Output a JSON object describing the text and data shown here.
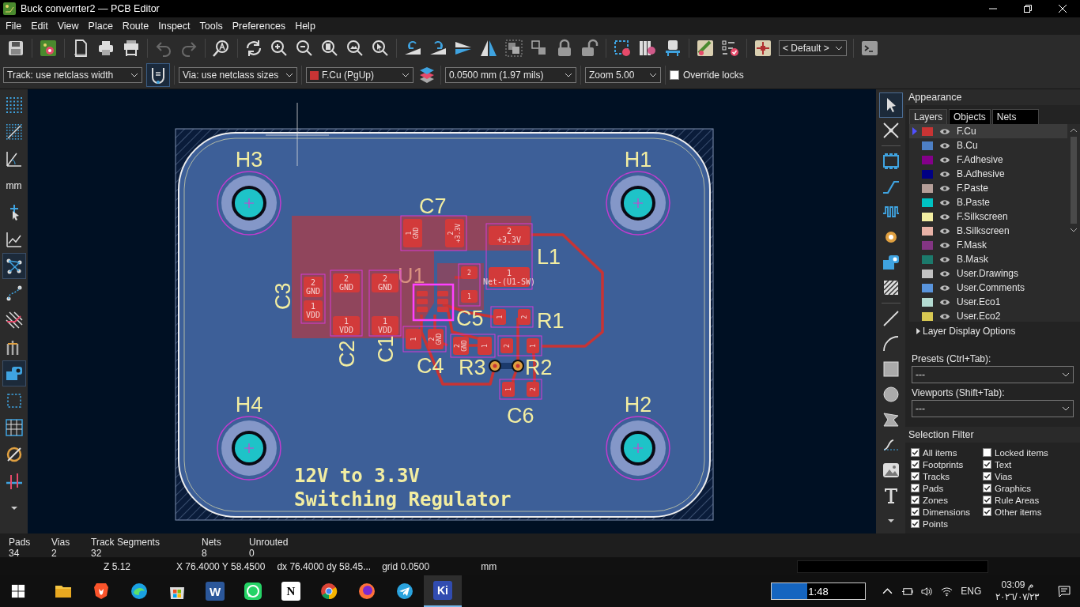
{
  "window": {
    "title": "Buck converrter2 — PCB Editor"
  },
  "menu": [
    "File",
    "Edit",
    "View",
    "Place",
    "Route",
    "Inspect",
    "Tools",
    "Preferences",
    "Help"
  ],
  "toolbar": [
    {
      "disabled": false
    },
    {
      "disabled": false
    },
    {
      "disabled": false
    },
    {
      "disabled": false
    },
    {
      "disabled": false
    },
    {
      "disabled": true
    },
    {
      "disabled": true
    },
    {
      "disabled": false
    },
    {
      "disabled": false
    },
    {
      "disabled": false
    },
    {
      "disabled": false
    },
    {
      "disabled": false
    },
    {
      "disabled": false
    },
    {
      "disabled": false
    },
    {
      "disabled": false
    },
    {
      "disabled": false
    },
    {
      "disabled": false
    },
    {
      "disabled": false
    },
    {
      "disabled": false
    },
    {
      "disabled": false
    },
    {
      "disabled": false
    },
    {
      "disabled": false
    },
    {
      "disabled": false
    },
    {
      "disabled": false
    },
    {
      "disabled": false
    },
    {
      "disabled": false
    },
    {
      "disabled": false
    },
    {
      "disabled": false
    },
    {
      "disabled": false
    }
  ],
  "viewport_dropdown": "< Default >",
  "options_bar": {
    "track": "Track: use netclass width",
    "via": "Via: use netclass sizes",
    "layer": {
      "label": "F.Cu (PgUp)",
      "color": "#c83434"
    },
    "grid": "0.0500 mm (1.97 mils)",
    "zoom": "Zoom 5.00",
    "override_locks": {
      "label": "Override locks",
      "checked": false
    }
  },
  "left_toolbar": [
    {
      "selected": false
    },
    {
      "selected": false
    },
    {
      "selected": false
    },
    {
      "selected": false,
      "label": "mm"
    },
    {
      "selected": false
    },
    {
      "selected": false
    },
    {
      "selected": true
    },
    {
      "selected": false
    },
    {
      "selected": false
    },
    {
      "selected": false
    },
    {
      "selected": true
    },
    {
      "selected": false
    },
    {
      "selected": false
    },
    {
      "selected": false
    },
    {
      "selected": false
    },
    {
      "selected": false
    }
  ],
  "right_toolbar": [
    {
      "selected": true
    },
    {
      "selected": false
    },
    {
      "selected": false
    },
    {
      "selected": false
    },
    {
      "selected": false
    },
    {
      "selected": false
    },
    {
      "selected": false
    },
    {
      "selected": false
    },
    {
      "selected": false
    },
    {
      "selected": false
    },
    {
      "selected": false
    },
    {
      "selected": false
    },
    {
      "selected": false
    },
    {
      "selected": false
    },
    {
      "selected": false
    },
    {
      "selected": false
    },
    {
      "selected": false
    }
  ],
  "board": {
    "holes": [
      {
        "ref": "H3"
      },
      {
        "ref": "H1"
      },
      {
        "ref": "H4"
      },
      {
        "ref": "H2"
      }
    ],
    "components": [
      {
        "ref": "C7",
        "color": "#f2eda1",
        "pads": [
          {
            "number": "1",
            "net": "GND"
          },
          {
            "number": "2",
            "net": "+3.3V"
          }
        ]
      },
      {
        "ref": "U1",
        "color": "#d9917f"
      },
      {
        "ref": "L1",
        "color": "#f2eda1",
        "pads": [
          {
            "number": "2",
            "net": "+3.3V"
          },
          {
            "number": "1",
            "net": "Net-(U1-SW)"
          }
        ]
      },
      {
        "ref": "C3",
        "color": "#f2eda1",
        "pads": [
          {
            "number": "2",
            "net": "GND"
          },
          {
            "number": "1",
            "net": "VDD"
          }
        ]
      },
      {
        "ref": "C2",
        "color": "#f2eda1",
        "pads": [
          {
            "number": "2",
            "net": "GND"
          },
          {
            "number": "1",
            "net": "VDD"
          }
        ]
      },
      {
        "ref": "C1",
        "color": "#f2eda1",
        "pads": [
          {
            "number": "2",
            "net": "GND"
          },
          {
            "number": "1",
            "net": "VDD"
          }
        ]
      },
      {
        "ref": "C5",
        "color": "#f2eda1",
        "pads": [
          {
            "number": "2"
          },
          {
            "number": "1"
          }
        ]
      },
      {
        "ref": "R1",
        "color": "#f2eda1",
        "pads": [
          {
            "number": "1"
          },
          {
            "number": "2"
          }
        ]
      },
      {
        "ref": "C4",
        "color": "#f2eda1",
        "pads": [
          {
            "number": "1"
          },
          {
            "number": "2",
            "net": "GND"
          }
        ]
      },
      {
        "ref": "R3",
        "color": "#f2eda1",
        "pads": [
          {
            "number": "2",
            "net": "GND"
          },
          {
            "number": "1"
          }
        ]
      },
      {
        "ref": "R2",
        "color": "#f2eda1",
        "pads": [
          {
            "number": "2"
          },
          {
            "number": "1"
          }
        ]
      },
      {
        "ref": "C6",
        "color": "#f2eda1",
        "pads": [
          {
            "number": "1"
          },
          {
            "number": "2"
          }
        ]
      }
    ],
    "title_lines": [
      "12V to 3.3V",
      "Switching Regulator"
    ]
  },
  "appearance": {
    "title": "Appearance",
    "tabs": [
      {
        "label": "Layers",
        "selected": true
      },
      {
        "label": "Objects",
        "selected": false
      },
      {
        "label": "Nets",
        "selected": false
      }
    ],
    "layers": [
      {
        "name": "F.Cu",
        "color": "#c83434",
        "selected": true
      },
      {
        "name": "B.Cu",
        "color": "#4d7fc4",
        "selected": false
      },
      {
        "name": "F.Adhesive",
        "color": "#84008a",
        "selected": false
      },
      {
        "name": "B.Adhesive",
        "color": "#000084",
        "selected": false
      },
      {
        "name": "F.Paste",
        "color": "#b59e98",
        "selected": false
      },
      {
        "name": "B.Paste",
        "color": "#00c2c2",
        "selected": false
      },
      {
        "name": "F.Silkscreen",
        "color": "#f2eda1",
        "selected": false
      },
      {
        "name": "B.Silkscreen",
        "color": "#e8b2a7",
        "selected": false
      },
      {
        "name": "F.Mask",
        "color": "#833583",
        "selected": false
      },
      {
        "name": "B.Mask",
        "color": "#1c7a6c",
        "selected": false
      },
      {
        "name": "User.Drawings",
        "color": "#c2c2c2",
        "selected": false
      },
      {
        "name": "User.Comments",
        "color": "#5994dc",
        "selected": false
      },
      {
        "name": "User.Eco1",
        "color": "#b4dbd2",
        "selected": false
      },
      {
        "name": "User.Eco2",
        "color": "#d8c852",
        "selected": false
      }
    ],
    "display_options": {
      "label": "Layer Display Options",
      "expanded": false
    },
    "presets": {
      "label": "Presets (Ctrl+Tab):",
      "value": "---"
    },
    "viewports": {
      "label": "Viewports (Shift+Tab):",
      "value": "---"
    },
    "selection_filter": {
      "title": "Selection Filter",
      "items": [
        {
          "label": "All items",
          "checked": true
        },
        {
          "label": "Locked items",
          "checked": false
        },
        {
          "label": "Footprints",
          "checked": true
        },
        {
          "label": "Text",
          "checked": true
        },
        {
          "label": "Tracks",
          "checked": true
        },
        {
          "label": "Vias",
          "checked": true
        },
        {
          "label": "Pads",
          "checked": true
        },
        {
          "label": "Graphics",
          "checked": true
        },
        {
          "label": "Zones",
          "checked": true
        },
        {
          "label": "Rule Areas",
          "checked": true
        },
        {
          "label": "Dimensions",
          "checked": true
        },
        {
          "label": "Other items",
          "checked": true
        },
        {
          "label": "Points",
          "checked": true
        }
      ]
    }
  },
  "status_bar": {
    "counts": [
      {
        "label": "Pads",
        "value": "34"
      },
      {
        "label": "Vias",
        "value": "2"
      },
      {
        "label": "Track Segments",
        "value": "32"
      },
      {
        "label": "Nets",
        "value": "8"
      },
      {
        "label": "Unrouted",
        "value": "0"
      }
    ],
    "zoom": "Z 5.12",
    "position": "X 76.4000  Y 58.4500",
    "delta": "dx 76.4000  dy 58.45...",
    "grid": "grid 0.0500",
    "units": "mm"
  },
  "taskbar": {
    "apps": [
      {
        "selected": false
      },
      {
        "selected": false
      },
      {
        "selected": false
      },
      {
        "selected": false
      },
      {
        "selected": false,
        "glyph": "W"
      },
      {
        "selected": false
      },
      {
        "selected": false,
        "glyph": "N"
      },
      {
        "selected": false
      },
      {
        "selected": false
      },
      {
        "selected": false
      },
      {
        "selected": true,
        "glyph": "Ki"
      }
    ],
    "media": {
      "time": "1:48",
      "level": 0.38
    },
    "language": "ENG",
    "clock": "03:09 م",
    "date": "٢٠٢٦/٠٧/٢٣"
  }
}
